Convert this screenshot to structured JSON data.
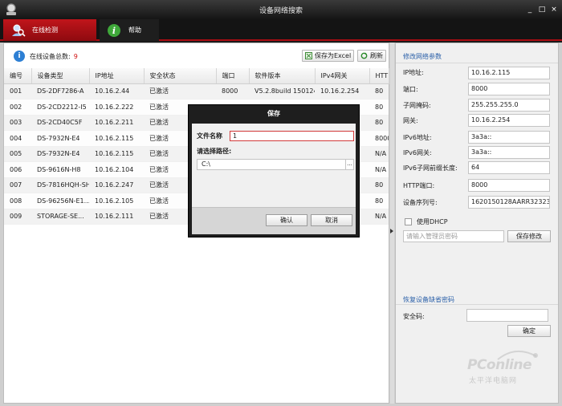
{
  "window": {
    "title": "设备网络搜索",
    "minimize": "_",
    "maximize": "□",
    "close": "×"
  },
  "tabs": [
    {
      "label": "在线检测",
      "icon": "search-person-icon",
      "active": true
    },
    {
      "label": "帮助",
      "icon": "info-icon",
      "active": false
    }
  ],
  "toolbar": {
    "count_label": "在线设备总数:",
    "count_value": "9",
    "export_label": "保存为Excel",
    "refresh_label": "刷新"
  },
  "table": {
    "headers": [
      "编号",
      "设备类型",
      "IP地址",
      "安全状态",
      "端口",
      "软件版本",
      "IPv4网关",
      "HTT"
    ],
    "rows": [
      [
        "001",
        "DS-2DF7286-A",
        "10.16.2.44",
        "已激活",
        "8000",
        "V5.2.8build 150124",
        "10.16.2.254",
        "80"
      ],
      [
        "002",
        "DS-2CD2212-I5",
        "10.16.2.222",
        "已激活",
        "",
        "",
        "",
        "80"
      ],
      [
        "003",
        "DS-2CD40C5F",
        "10.16.2.211",
        "已激活",
        "",
        "",
        "",
        "80"
      ],
      [
        "004",
        "DS-7932N-E4",
        "10.16.2.115",
        "已激活",
        "",
        "",
        "",
        "8000"
      ],
      [
        "005",
        "DS-7932N-E4",
        "10.16.2.115",
        "已激活",
        "",
        "",
        "",
        "N/A"
      ],
      [
        "006",
        "DS-9616N-H8",
        "10.16.2.104",
        "已激活",
        "",
        "",
        "",
        "N/A"
      ],
      [
        "007",
        "DS-7816HQH-SH",
        "10.16.2.247",
        "已激活",
        "",
        "",
        "",
        "80"
      ],
      [
        "008",
        "DS-96256N-E1...",
        "10.16.2.105",
        "已激活",
        "",
        "",
        "",
        "80"
      ],
      [
        "009",
        "STORAGE-SE...",
        "10.16.2.111",
        "已激活",
        "",
        "",
        "",
        "N/A"
      ]
    ]
  },
  "right_panel": {
    "modify_title": "修改网络参数",
    "fields": [
      {
        "label": "IP地址:",
        "value": "10.16.2.115"
      },
      {
        "label": "端口:",
        "value": "8000"
      },
      {
        "label": "子网掩码:",
        "value": "255.255.255.0"
      },
      {
        "label": "网关:",
        "value": "10.16.2.254"
      },
      {
        "label": "IPv6地址:",
        "value": "3a3a::"
      },
      {
        "label": "IPv6网关:",
        "value": "3a3a::"
      },
      {
        "label": "IPv6子网前缀长度:",
        "value": "64"
      },
      {
        "label": "HTTP端口:",
        "value": "8000"
      },
      {
        "label": "设备序列号:",
        "value": "1620150128AARR323232"
      }
    ],
    "dhcp_label": "使用DHCP",
    "password_placeholder": "请输入管理员密码",
    "save_button": "保存修改",
    "restore_title": "恢复设备缺省密码",
    "security_label": "安全码:",
    "confirm_button": "确定"
  },
  "dialog": {
    "title": "保存",
    "filename_label": "文件名称",
    "filename_value": "1",
    "path_label": "请选择路径:",
    "path_value": "C:\\",
    "browse": "...",
    "ok_label": "确认",
    "cancel_label": "取消"
  },
  "watermark": {
    "text": "PConline",
    "subtext": "太平洋电脑网"
  }
}
